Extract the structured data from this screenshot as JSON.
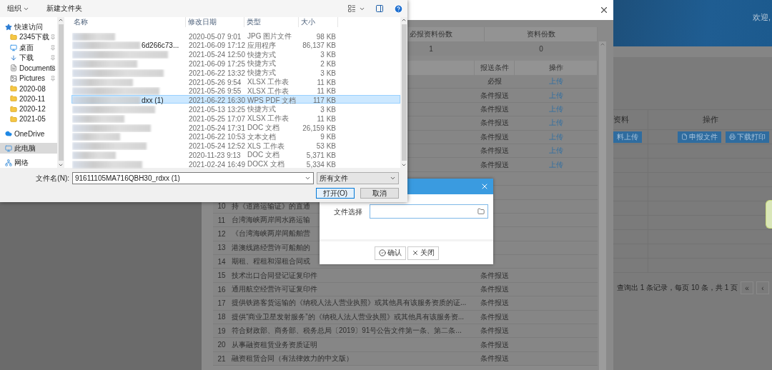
{
  "page": {
    "welcome": "欢迎,",
    "table": {
      "columns": [
        "资料",
        "操作"
      ],
      "buttons": [
        {
          "label": "料上传",
          "kind": "plain"
        },
        {
          "label": "申报文件",
          "kind": "file"
        },
        {
          "label": "下载打印",
          "kind": "print"
        }
      ]
    },
    "pagination": {
      "summary": "查询出 1 条记录，每页 10 条，共 1 页",
      "buttons": [
        "«",
        "‹"
      ]
    }
  },
  "modal": {
    "summary": {
      "columns": [
        "必报资料份数",
        "资料份数"
      ],
      "values": [
        "1",
        "0"
      ]
    },
    "columns": [
      "报送条件",
      "操作"
    ],
    "rows": [
      {
        "condition": "必报",
        "action": "上传"
      },
      {
        "condition": "条件报送",
        "action": "上传"
      },
      {
        "condition": "条件报送",
        "action": "上传"
      },
      {
        "condition": "条件报送",
        "action": "上传"
      },
      {
        "condition": "条件报送",
        "action": "上传"
      },
      {
        "condition": "条件报送",
        "action": "上传"
      },
      {
        "condition": "条件报送",
        "action": "上传"
      },
      {},
      {},
      {
        "number": "10",
        "name": "持《道路运输证》的直通"
      },
      {
        "number": "11",
        "name": "台湾海峡两岸间水路运输"
      },
      {
        "number": "12",
        "name": "《台湾海峡两岸间船舶营"
      },
      {
        "number": "13",
        "name": "港澳线路经营许可船舶的"
      },
      {
        "number": "14",
        "name": "期租、程租和湿租合同或"
      },
      {
        "number": "15",
        "name": "技术出口合同登记证复印件",
        "condition": "条件报送"
      },
      {
        "number": "16",
        "name": "通用航空经营许可证复印件",
        "condition": "条件报送"
      },
      {
        "number": "17",
        "name": "提供铁路客货运输的《纳税人法人营业执照》或其他具有该服务资质的证...",
        "condition": "条件报送"
      },
      {
        "number": "18",
        "name": "提供“商业卫星发射服务”的《纳税人法人营业执照》或其他具有该服务资...",
        "condition": "条件报送"
      },
      {
        "number": "19",
        "name": "符合财政部、商务部、税务总局〔2019〕91号公告文件第一条、第二条...",
        "condition": "条件报送"
      },
      {
        "number": "20",
        "name": "从事融资租赁业务资质证明",
        "condition": "条件报送"
      },
      {
        "number": "21",
        "name": "融资租赁合同（有法律效力的中文版）",
        "condition": "条件报送"
      }
    ]
  },
  "file_dialog": {
    "toolbar": [
      "组织",
      "新建文件夹"
    ],
    "nav": [
      {
        "label": "快速访问",
        "kind": "star",
        "pinned": false,
        "selected": false
      },
      {
        "label": "2345下载",
        "kind": "folder",
        "pinned": true,
        "selected": false
      },
      {
        "label": "桌面",
        "kind": "desktop",
        "pinned": true,
        "selected": false
      },
      {
        "label": "下载",
        "kind": "download",
        "pinned": true,
        "selected": false
      },
      {
        "label": "Documents",
        "kind": "documents",
        "pinned": true,
        "selected": false
      },
      {
        "label": "Pictures",
        "kind": "pictures",
        "pinned": true,
        "selected": false
      },
      {
        "label": "2020-08",
        "kind": "folder",
        "pinned": false,
        "selected": false
      },
      {
        "label": "2020-11",
        "kind": "folder",
        "pinned": false,
        "selected": false
      },
      {
        "label": "2020-12",
        "kind": "folder",
        "pinned": false,
        "selected": false
      },
      {
        "label": "2021-05",
        "kind": "folder",
        "pinned": false,
        "selected": false
      },
      {
        "label": "OneDrive",
        "kind": "cloud",
        "pinned": false,
        "selected": false
      },
      {
        "label": "此电脑",
        "kind": "pc",
        "pinned": false,
        "selected": true
      },
      {
        "label": "网络",
        "kind": "network",
        "pinned": false,
        "selected": false
      }
    ],
    "columns": [
      "名称",
      "修改日期",
      "类型",
      "大小"
    ],
    "files": [
      {
        "date": "2020-05-07 9:01",
        "type": "JPG 图片文件",
        "size": "98 KB",
        "selected": false
      },
      {
        "name": "6d266c73...",
        "date": "2021-06-09 17:12",
        "type": "应用程序",
        "size": "86,137 KB",
        "selected": false
      },
      {
        "date": "2021-05-24 12:50",
        "type": "快捷方式",
        "size": "3 KB",
        "selected": false
      },
      {
        "date": "2021-06-09 17:25",
        "type": "快捷方式",
        "size": "2 KB",
        "selected": false
      },
      {
        "date": "2021-06-22 13:32",
        "type": "快捷方式",
        "size": "3 KB",
        "selected": false
      },
      {
        "date": "2021-05-26 9:54",
        "type": "XLSX 工作表",
        "size": "11 KB",
        "selected": false
      },
      {
        "date": "2021-05-26 9:55",
        "type": "XLSX 工作表",
        "size": "11 KB",
        "selected": false
      },
      {
        "name": "dxx (1)",
        "date": "2021-06-22 16:30",
        "type": "WPS PDF 文档",
        "size": "117 KB",
        "selected": true
      },
      {
        "date": "2021-05-13 13:25",
        "type": "快捷方式",
        "size": "3 KB",
        "selected": false
      },
      {
        "date": "2021-05-25 17:07",
        "type": "XLSX 工作表",
        "size": "11 KB",
        "selected": false
      },
      {
        "date": "2021-05-24 17:31",
        "type": "DOC 文档",
        "size": "26,159 KB",
        "selected": false
      },
      {
        "date": "2021-06-22 10:53",
        "type": "文本文档",
        "size": "9 KB",
        "selected": false
      },
      {
        "date": "2021-05-24 12:52",
        "type": "XLS 工作表",
        "size": "53 KB",
        "selected": false
      },
      {
        "date": "2020-11-23 9:13",
        "type": "DOC 文档",
        "size": "5,371 KB",
        "selected": false
      },
      {
        "date": "2021-02-24 16:49",
        "type": "DOCX 文档",
        "size": "5,334 KB",
        "selected": false
      }
    ],
    "file_name": {
      "label": "文件名(N):",
      "value": "91611105MA716QBH30_rdxx (1)"
    },
    "filter": "所有文件",
    "buttons": [
      {
        "label": "打开(O)",
        "kind": "primary"
      },
      {
        "label": "取消",
        "kind": "normal"
      }
    ]
  },
  "upload_dialog": {
    "label": "文件选择",
    "buttons": [
      {
        "label": "确认",
        "kind": "confirm"
      },
      {
        "label": "关闭",
        "kind": "close"
      }
    ]
  }
}
